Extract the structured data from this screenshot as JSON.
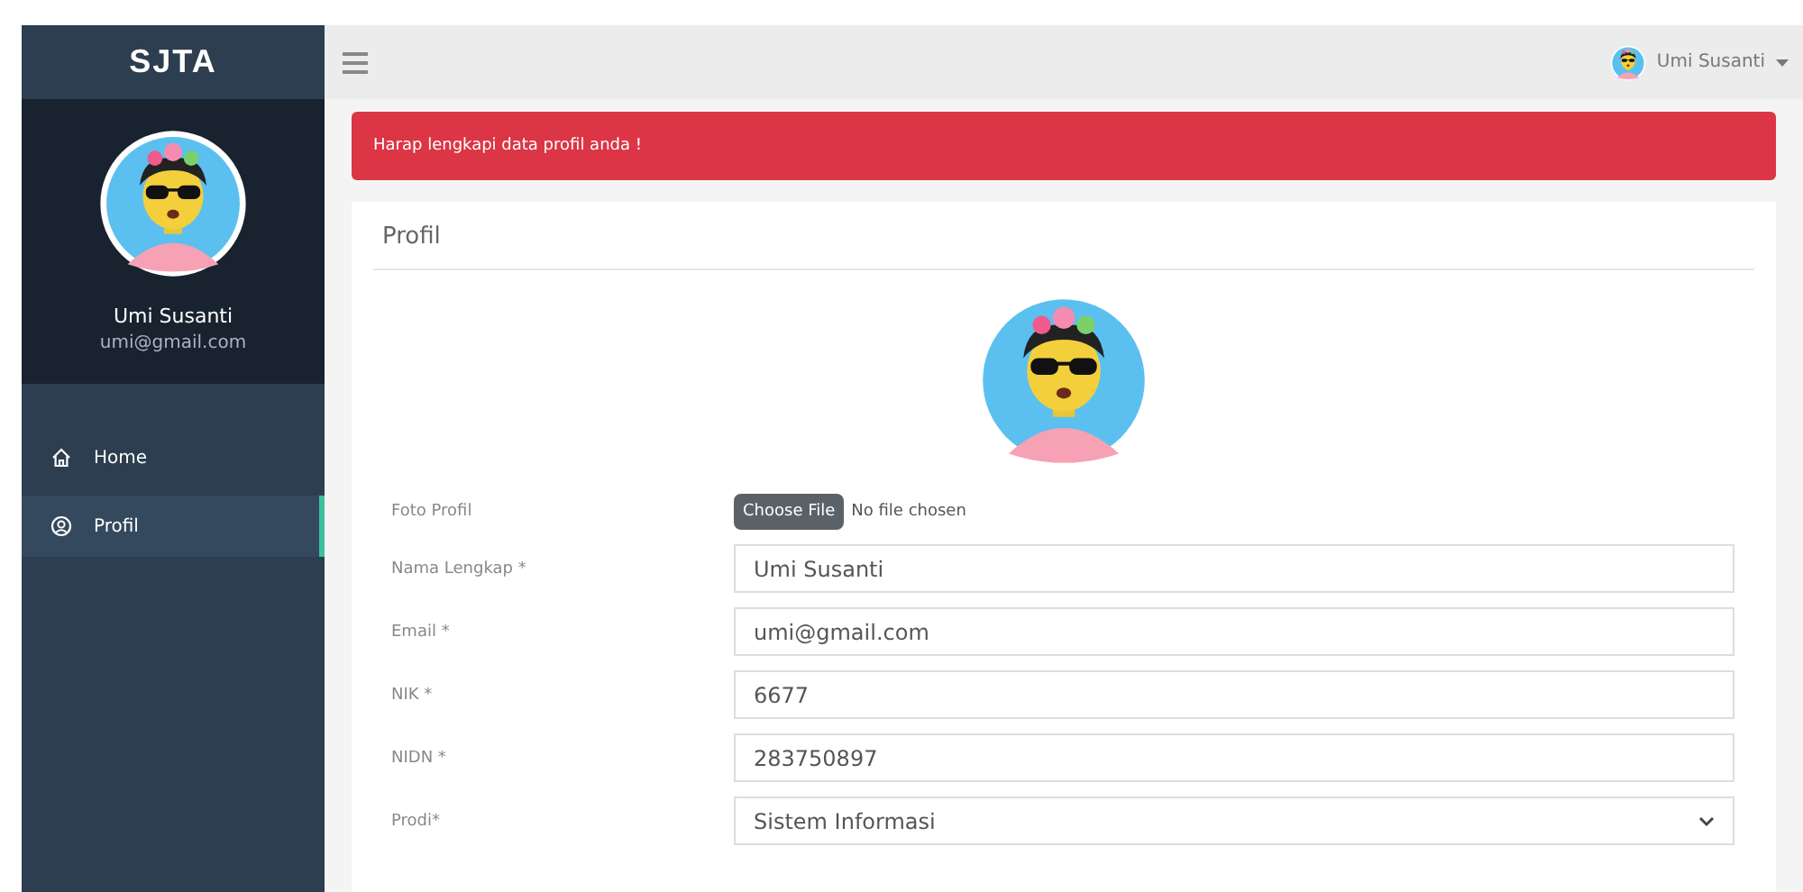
{
  "sidebar": {
    "brand": "SJTA",
    "user": {
      "name": "Umi Susanti",
      "email": "umi@gmail.com"
    },
    "items": [
      {
        "kind": "home",
        "label": "Home",
        "selected": false
      },
      {
        "kind": "user",
        "label": "Profil",
        "selected": true
      }
    ]
  },
  "topbar": {
    "user_name": "Umi Susanti"
  },
  "alert": {
    "text": "Harap lengkapi data profil anda !"
  },
  "card": {
    "title": "Profil",
    "fields": [
      {
        "kind": "file",
        "label": "Foto Profil",
        "button": "Choose File",
        "status": "No file chosen"
      },
      {
        "kind": "text",
        "label": "Nama Lengkap *",
        "value": "Umi Susanti"
      },
      {
        "kind": "text",
        "label": "Email *",
        "value": "umi@gmail.com"
      },
      {
        "kind": "text",
        "label": "NIK *",
        "value": "6677"
      },
      {
        "kind": "text",
        "label": "NIDN *",
        "value": "283750897"
      },
      {
        "kind": "select",
        "label": "Prodi*",
        "value": "Sistem Informasi"
      }
    ]
  }
}
